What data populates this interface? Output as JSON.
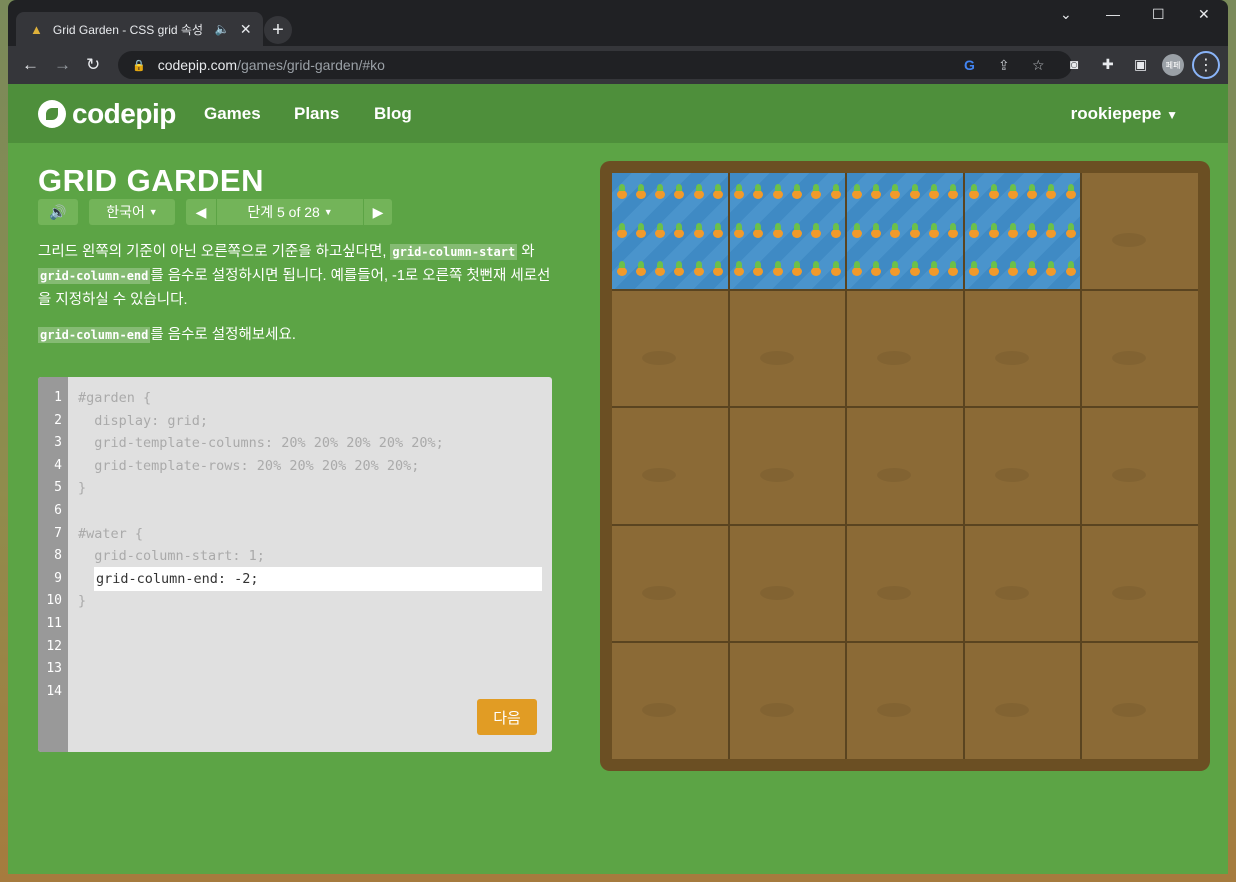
{
  "browser": {
    "tab_title": "Grid Garden - CSS grid 속성",
    "url_host": "codepip.com",
    "url_path": "/games/grid-garden/#ko",
    "profile_label": "페페"
  },
  "site": {
    "logo": "codepip",
    "nav": [
      "Games",
      "Plans",
      "Blog"
    ],
    "user": "rookiepepe"
  },
  "game": {
    "title": "GRID GARDEN",
    "language": "한국어",
    "level_label": "단계 5 of 28",
    "instructions": {
      "p1": "그리드 왼쪽의 기준이 아닌 오른쪽으로 기준을 하고싶다면, ",
      "code1": "grid-column-start",
      "p2": " 와 ",
      "code2": "grid-column-end",
      "p3": "를 음수로 설정하시면 됩니다. 예를들어, -1로 오른쪽 첫뻔재 세로선을 지정하실 수 있습니다."
    },
    "task": {
      "code": "grid-column-end",
      "text": "를 음수로 설정해보세요."
    },
    "editor": {
      "line_numbers": [
        "1",
        "2",
        "3",
        "4",
        "5",
        "6",
        "7",
        "8",
        "9",
        "10",
        "11",
        "12",
        "13",
        "14"
      ],
      "code_lines": [
        "#garden {",
        "  display: grid;",
        "  grid-template-columns: 20% 20% 20% 20% 20%;",
        "  grid-template-rows: 20% 20% 20% 20% 20%;",
        "}",
        "",
        "#water {",
        "  grid-column-start: 1;",
        "",
        "}"
      ],
      "input_value": "grid-column-end: -2;",
      "next_button": "다음"
    },
    "garden": {
      "columns": 5,
      "rows": 5,
      "water_columns": [
        1,
        2,
        3,
        4
      ],
      "water_row": 1
    }
  },
  "colors": {
    "page_green": "#5ca445",
    "header_green": "#4e8f3b",
    "soil": "#8b6a36",
    "water": "#3f8ac4",
    "next_button": "#e19c24"
  }
}
